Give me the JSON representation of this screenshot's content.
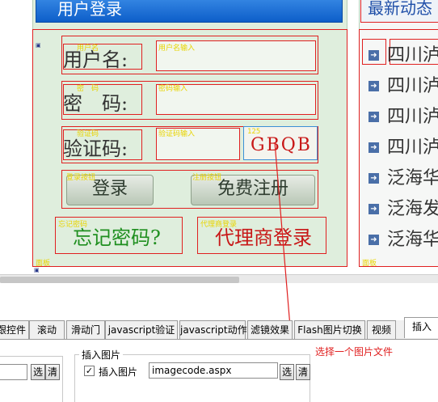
{
  "login_panel": {
    "header_title": "用户登录",
    "username_label": "用户名:",
    "password_label": "密　码:",
    "captcha_label": "验证码:",
    "captcha_image_text": "GBQB",
    "captcha_tag": "125",
    "login_button": "登录",
    "register_button": "免费注册",
    "forgot_link": "忘记密码?",
    "agent_link": "代理商登录",
    "row_tags": [
      "用户名",
      "密　码",
      "验证码"
    ],
    "input_tags": [
      "用户名输入",
      "密码输入",
      "验证码输入"
    ],
    "button_tags": [
      "登录按钮",
      "注册按钮",
      "忘记密码",
      "代理商登录"
    ],
    "bottom_tag": "面板"
  },
  "news_panel": {
    "header_title": "最新动态",
    "items": [
      "四川泸",
      "四川泸",
      "四川泸",
      "四川泸",
      "泛海华",
      "泛海发",
      "泛海华"
    ],
    "bottom_tag": "面板"
  },
  "tabs": [
    "跟控件",
    "滚动",
    "滑动门",
    "javascript验证",
    "javascript动作",
    "滤镜效果",
    "Flash图片切换",
    "视频",
    "插入"
  ],
  "active_tab": "插入",
  "insert_image_group": {
    "title": "插入图片",
    "checkbox_label": "插入图片",
    "checkbox_checked": true,
    "path_value": "imagecode.aspx",
    "select_button": "选",
    "clear_button": "清"
  },
  "left_group": {
    "select_button": "选",
    "clear_button": "清"
  },
  "annotation": {
    "text": "选择一个图片文件",
    "color": "#e02020"
  }
}
